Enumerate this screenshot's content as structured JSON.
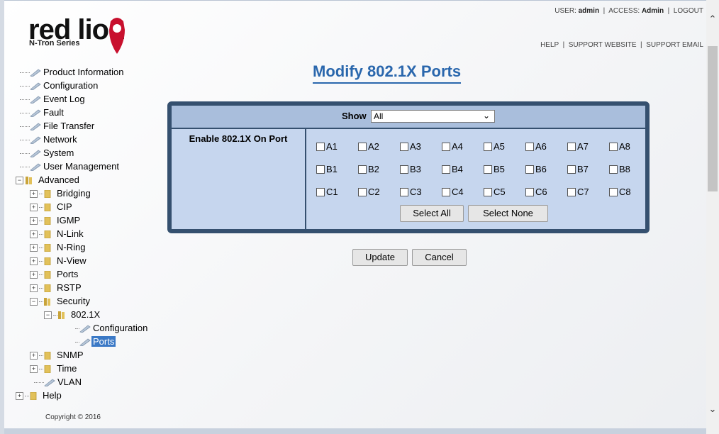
{
  "header": {
    "logo_text": "red lion",
    "logo_sub": "N-Tron Series",
    "user_label": "USER:",
    "user_value": "admin",
    "access_label": "ACCESS:",
    "access_value": "Admin",
    "logout": "LOGOUT",
    "help": "HELP",
    "support_website": "SUPPORT WEBSITE",
    "support_email": "SUPPORT EMAIL"
  },
  "nav": {
    "product_information": "Product Information",
    "configuration": "Configuration",
    "event_log": "Event Log",
    "fault": "Fault",
    "file_transfer": "File Transfer",
    "network": "Network",
    "system": "System",
    "user_management": "User Management",
    "advanced": "Advanced",
    "bridging": "Bridging",
    "cip": "CIP",
    "igmp": "IGMP",
    "nlink": "N-Link",
    "nring": "N-Ring",
    "nview": "N-View",
    "ports": "Ports",
    "rstp": "RSTP",
    "security": "Security",
    "dot1x": "802.1X",
    "dot1x_configuration": "Configuration",
    "dot1x_ports": "Ports",
    "snmp": "SNMP",
    "time": "Time",
    "vlan": "VLAN",
    "help": "Help"
  },
  "footer": {
    "copyright": "Copyright © 2016"
  },
  "page": {
    "title": "Modify 802.1X Ports"
  },
  "form": {
    "show_label": "Show",
    "show_value": "All",
    "enable_label": "Enable 802.1X On Port",
    "ports": {
      "A1": "A1",
      "A2": "A2",
      "A3": "A3",
      "A4": "A4",
      "A5": "A5",
      "A6": "A6",
      "A7": "A7",
      "A8": "A8",
      "B1": "B1",
      "B2": "B2",
      "B3": "B3",
      "B4": "B4",
      "B5": "B5",
      "B6": "B6",
      "B7": "B7",
      "B8": "B8",
      "C1": "C1",
      "C2": "C2",
      "C3": "C3",
      "C4": "C4",
      "C5": "C5",
      "C6": "C6",
      "C7": "C7",
      "C8": "C8"
    },
    "checked": [],
    "select_all": "Select All",
    "select_none": "Select None"
  },
  "actions": {
    "update": "Update",
    "cancel": "Cancel"
  },
  "colors": {
    "accent": "#2a67ad",
    "panel_border": "#35506f",
    "panel_header": "#a9bedc",
    "panel_cell": "#c6d6ee",
    "selected": "#3b79c6"
  }
}
